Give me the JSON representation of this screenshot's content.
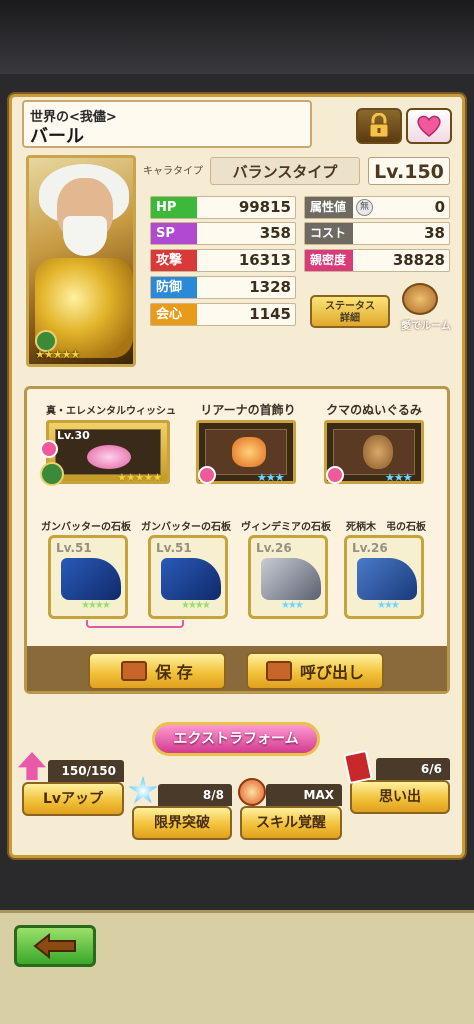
{
  "header": {
    "subtitle": "世界の<我儘>",
    "name": "バール"
  },
  "type_label": "キャラタイプ",
  "type_value": "バランスタイプ",
  "level": "Lv.150",
  "stats_left": [
    {
      "label": "HP",
      "value": "99815",
      "color": "#3eb83a"
    },
    {
      "label": "SP",
      "value": "358",
      "color": "#b04ad0"
    },
    {
      "label": "攻撃",
      "value": "16313",
      "color": "#d83a3a"
    },
    {
      "label": "防御",
      "value": "1328",
      "color": "#2a8ad8"
    },
    {
      "label": "会心",
      "value": "1145",
      "color": "#e89a1a"
    }
  ],
  "stats_right": [
    {
      "label": "属性値",
      "value": "0",
      "badge": "無"
    },
    {
      "label": "コスト",
      "value": "38"
    },
    {
      "label": "親密度",
      "value": "38828",
      "color": "#d83a7a"
    }
  ],
  "status_button": {
    "line1": "ステータス",
    "line2": "詳細"
  },
  "room_button": "愛でルーム",
  "accessories": [
    {
      "title": "真・エレメンタルウィッシュ",
      "lv": "Lv.30",
      "stars": "★★★★★"
    },
    {
      "title": "リアーナの首飾り",
      "stars": "★★★"
    },
    {
      "title": "クマのぬいぐるみ",
      "stars": "★★★"
    }
  ],
  "tablets": [
    {
      "title": "ガンバッターの石板",
      "lv": "Lv.51",
      "stars": "★★★★"
    },
    {
      "title": "ガンバッターの石板",
      "lv": "Lv.51",
      "stars": "★★★★"
    },
    {
      "title": "ヴィンデミアの石板",
      "lv": "Lv.26",
      "stars": "★★★"
    },
    {
      "title": "死柄木　弔の石板",
      "lv": "Lv.26",
      "stars": "★★★"
    }
  ],
  "actions": {
    "save": "保 存",
    "load": "呼び出し"
  },
  "extra_form": "エクストラフォーム",
  "boosts": {
    "levelup": {
      "count": "150/150",
      "label": "Lvアップ"
    },
    "limit": {
      "count": "8/8",
      "label": "限界突破"
    },
    "skill": {
      "count": "MAX",
      "label": "スキル覚醒"
    },
    "memory": {
      "count": "6/6",
      "label": "思い出"
    }
  },
  "icons": [
    "lock-icon",
    "heart-icon",
    "back-arrow-icon",
    "save-icon",
    "load-icon",
    "room-icon"
  ]
}
